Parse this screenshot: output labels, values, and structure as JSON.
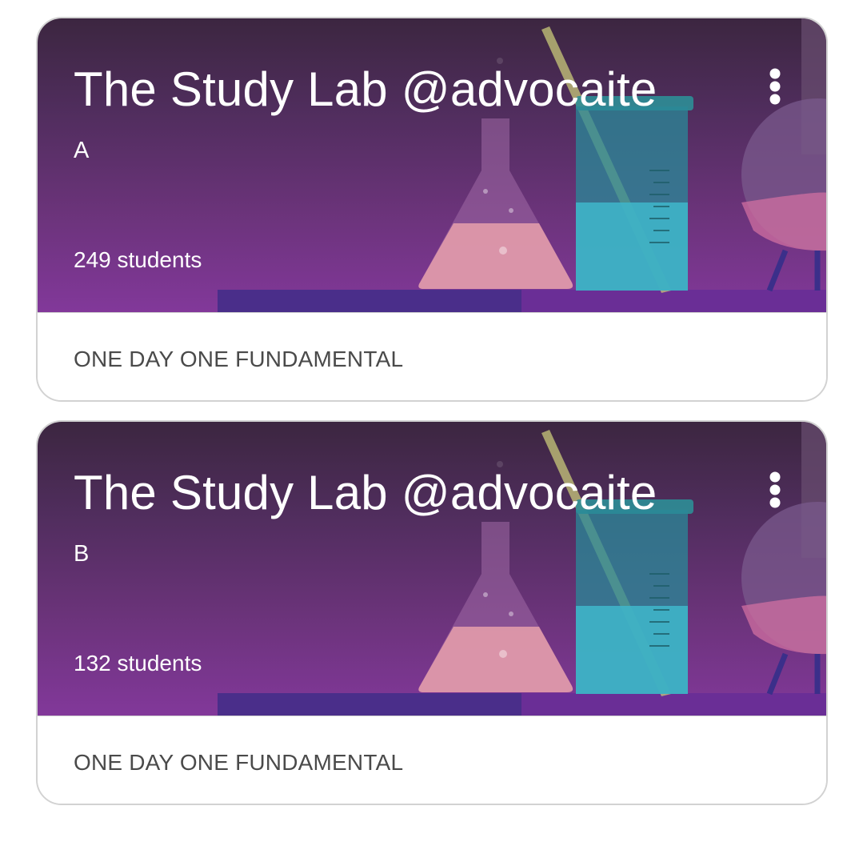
{
  "classes": [
    {
      "title": "The Study Lab @advocaite",
      "section": "A",
      "student_count": "249 students",
      "description": "ONE DAY ONE FUNDAMENTAL",
      "menu_icon": "more-vert-icon"
    },
    {
      "title": "The Study Lab @advocaite",
      "section": "B",
      "student_count": "132 students",
      "description": "ONE DAY ONE FUNDAMENTAL",
      "menu_icon": "more-vert-icon"
    }
  ],
  "colors": {
    "banner_top": "#3c2640",
    "banner_bottom": "#82389a",
    "beaker": "#3fb4c8",
    "flask_liquid": "#e7a0ac",
    "shelf": "#4a2e8a",
    "footer_text": "#4a4a4a"
  }
}
